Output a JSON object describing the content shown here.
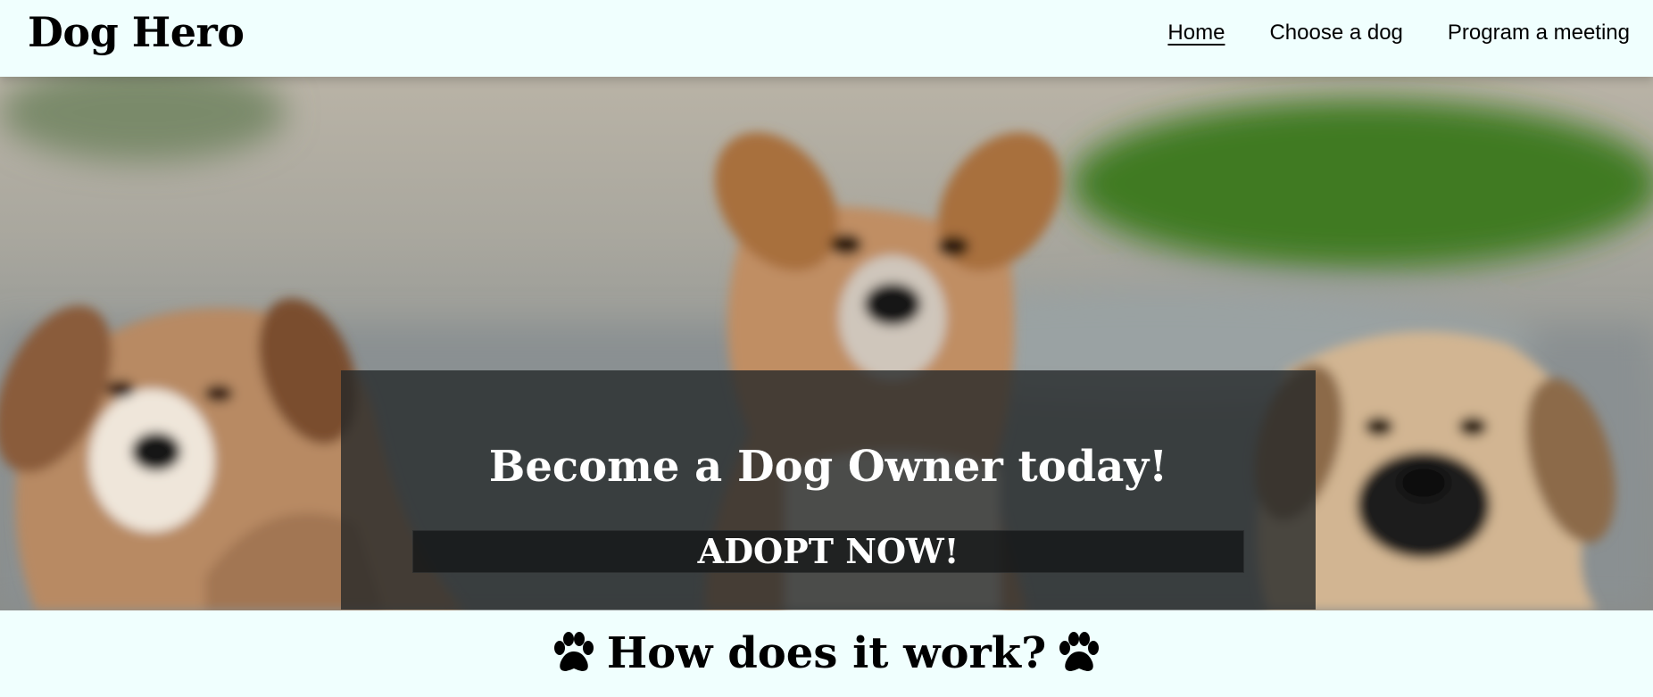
{
  "header": {
    "brand": "Dog Hero",
    "nav": [
      {
        "label": "Home",
        "active": true
      },
      {
        "label": "Choose a dog",
        "active": false
      },
      {
        "label": "Program a meeting",
        "active": false
      }
    ]
  },
  "hero": {
    "image": "three-puppies-photo",
    "heading": "Become a Dog Owner today!",
    "cta_label": "ADOPT NOW!"
  },
  "section": {
    "title": "How does it work?",
    "icon": "paw-icon"
  },
  "colors": {
    "page_bg": "#f0fffe",
    "overlay": "#222628",
    "text_light": "#ffffff"
  }
}
